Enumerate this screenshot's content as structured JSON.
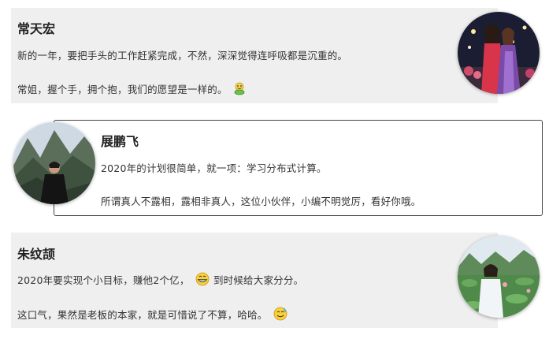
{
  "entries": [
    {
      "name": "常天宏",
      "lines": [
        "新的一年，要把手头的工作赶紧完成，不然，深深觉得连呼吸都是沉重的。",
        "常姐，握个手，拥个抱，我们的愿望是一样的。"
      ],
      "avatar": "photo-two-women-stage",
      "emoji": "handshake-icon"
    },
    {
      "name": "展鹏飞",
      "lines": [
        "2020年的计划很简单，就一项：学习分布式计算。",
        "所谓真人不露相，露相非真人，这位小伙伴，小编不明觉厉，看好你哦。"
      ],
      "avatar": "photo-man-mountains"
    },
    {
      "name": "朱纹颉",
      "lines_a": "2020年要实现个小目标，赚他2个亿，",
      "lines_b": "到时候给大家分分。",
      "line2": "这口气，果然是老板的本家，就是可惜说了不算，哈哈。",
      "avatar": "photo-woman-lotus-pond",
      "emojis": [
        "grin-icon",
        "sweat-smile-icon"
      ]
    }
  ],
  "colors": {
    "card_gray": "#efefef",
    "card_border": "#444444"
  }
}
